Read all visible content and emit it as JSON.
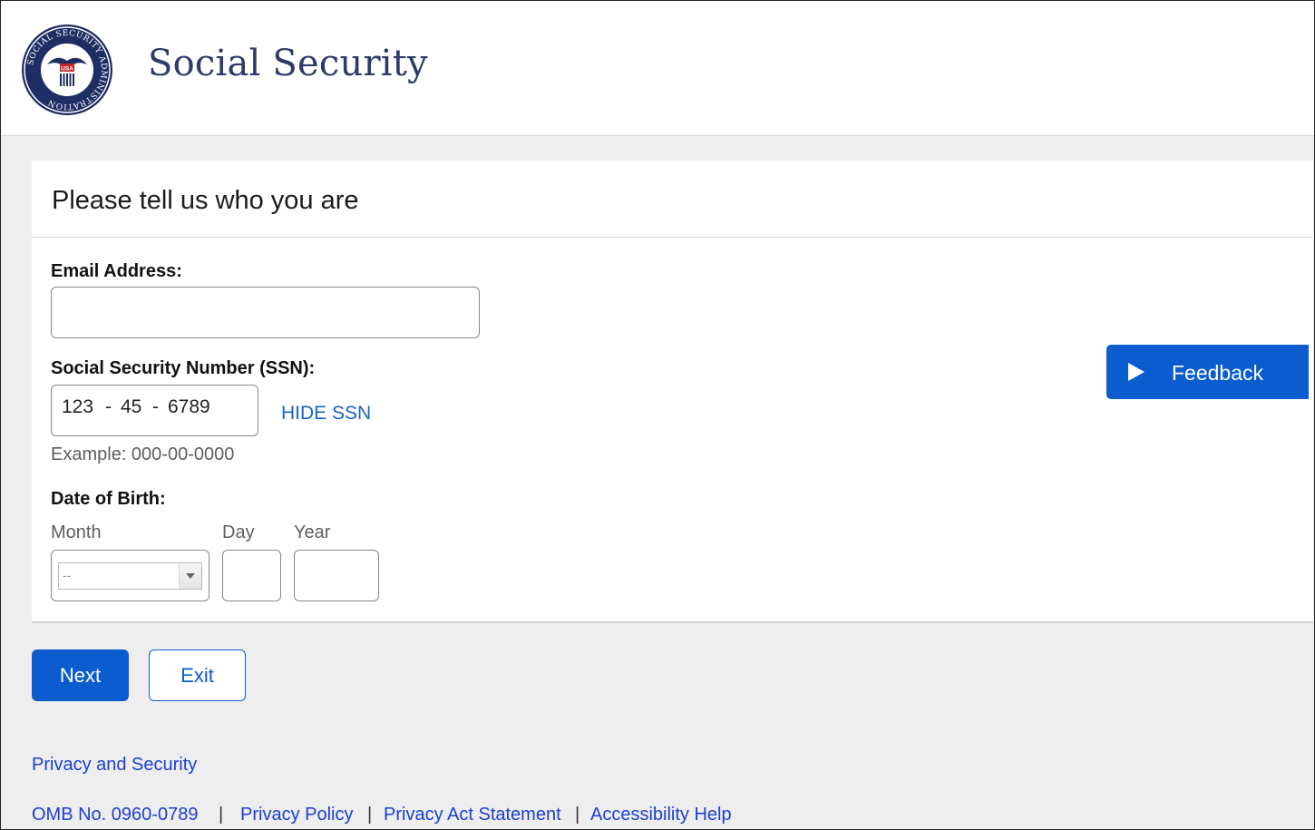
{
  "header": {
    "site_title": "Social Security",
    "logo": {
      "icon": "ssa-seal",
      "ring_text": "SOCIAL SECURITY ADMINISTRATION",
      "center_text": "USA"
    }
  },
  "form": {
    "title": "Please tell us who you are",
    "email": {
      "label": "Email Address:",
      "value": ""
    },
    "ssn": {
      "label": "Social Security Number (SSN):",
      "part1": "123",
      "part2": "45",
      "part3": "6789",
      "separator": "-",
      "toggle_label": "HIDE SSN",
      "example": "Example: 000-00-0000"
    },
    "dob": {
      "label": "Date of Birth:",
      "month_label": "Month",
      "day_label": "Day",
      "year_label": "Year",
      "month_value": "--",
      "day_value": "",
      "year_value": ""
    }
  },
  "feedback": {
    "label": "Feedback",
    "icon": "play-icon"
  },
  "actions": {
    "next_label": "Next",
    "exit_label": "Exit"
  },
  "footer": {
    "privacy_security": "Privacy and Security",
    "omb": "OMB No. 0960-0789",
    "separator": "|",
    "privacy_policy": "Privacy Policy",
    "privacy_act": "Privacy Act Statement",
    "accessibility": "Accessibility Help"
  },
  "colors": {
    "primary_blue": "#0b5ccf",
    "link_blue": "#1863c9",
    "footer_link": "#1a3fd4",
    "title_navy": "#2f3a6a",
    "page_bg": "#eeeeee"
  }
}
